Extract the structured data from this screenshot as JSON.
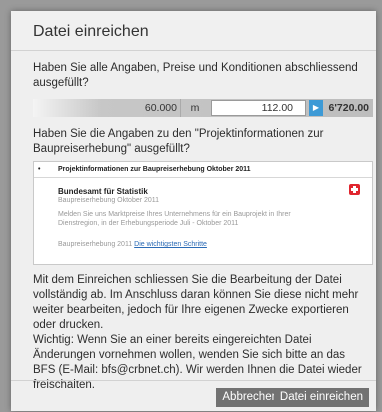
{
  "dialog": {
    "title": "Datei einreichen",
    "question1": "Haben Sie alle Angaben, Preise und Konditionen abschliessend ausgefüllt?",
    "price_bar": {
      "quantity": "60.000",
      "unit": "m",
      "unit_price": "112.00",
      "total": "6'720.00"
    },
    "question2": "Haben Sie die Angaben zu den \"Projektinformationen zur Baupreiserhebung\" ausgefüllt?",
    "thumbnail": {
      "header": "Projektinformationen zur Baupreiserhebung Oktober 2011",
      "org": "Bundesamt für Statistik",
      "subtitle": "Baupreiserhebung Oktober 2011",
      "description": "Melden Sie uns Marktpreise Ihres Unternehmens für ein Bauprojekt in Ihrer Dienstregion, in der Erhebungsperiode Juli - Oktober 2011",
      "footer_text": "Baupreiserhebung 2011",
      "footer_link": "Die wichtigsten Schritte"
    },
    "info_text": "Mit dem Einreichen schliessen Sie die Bearbeitung der Datei vollständig ab. Im Anschluss daran können Sie diese nicht mehr weiter bearbeiten, jedoch für Ihre eigenen Zwecke exportieren oder drucken.",
    "warning_text": "Wichtig: Wenn Sie an einer bereits eingereichten Datei Änderungen vornehmen wollen, wenden Sie sich bitte an das BFS (E-Mail: bfs@crbnet.ch). Wir werden Ihnen die Datei wieder freischalten.",
    "buttons": {
      "cancel": "Abbrechen",
      "submit": "Datei einreichen"
    }
  }
}
